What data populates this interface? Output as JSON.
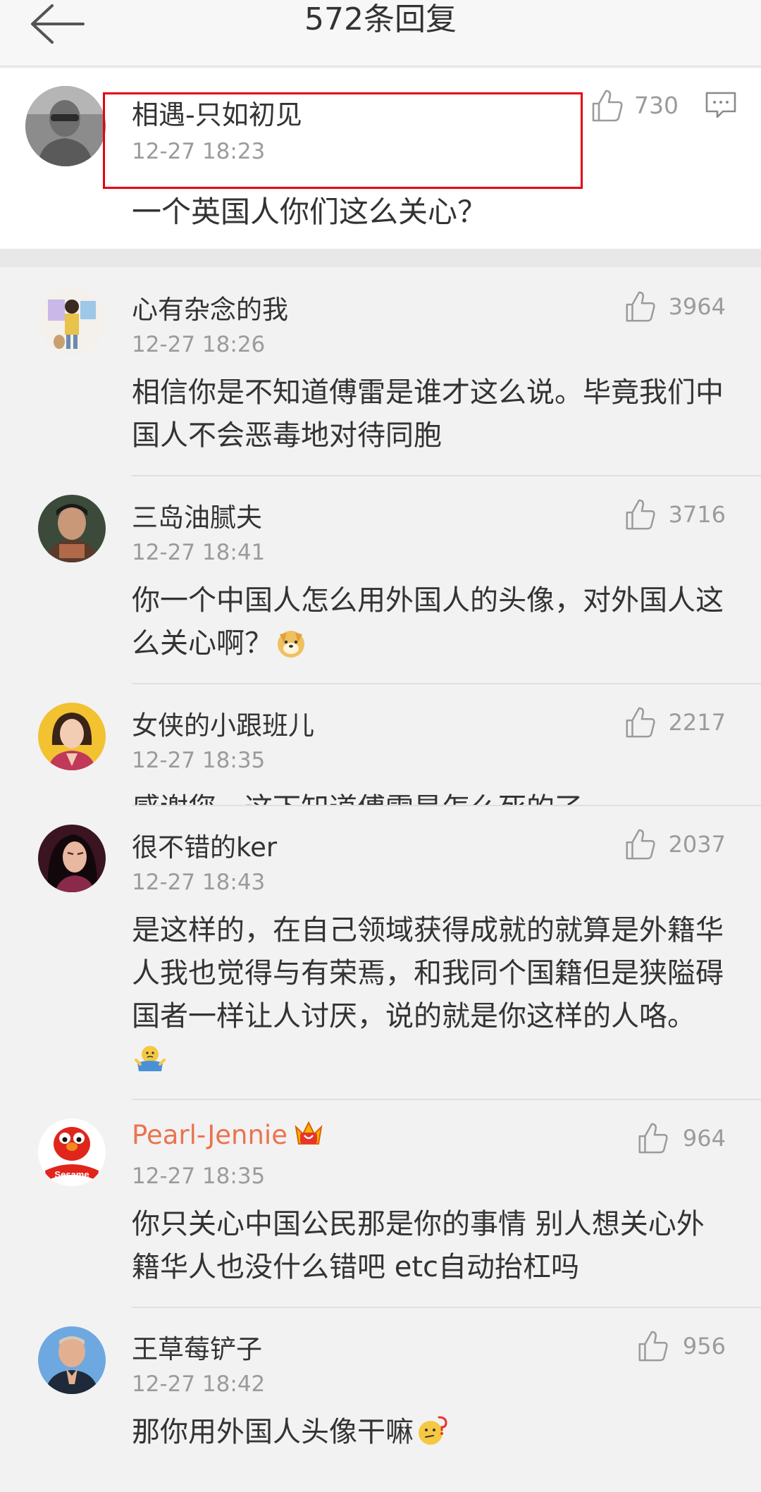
{
  "header": {
    "title": "572条回复",
    "back_icon": "arrow-left-icon"
  },
  "op": {
    "name": "相遇-只如初见",
    "time": "12-27 18:23",
    "likes": "730",
    "text": "一个英国人你们这么关心？",
    "highlight_color": "#e60012"
  },
  "replies": [
    {
      "name": "心有杂念的我",
      "time": "12-27 18:26",
      "likes": "3964",
      "text": "相信你是不知道傅雷是谁才这么说。毕竟我们中国人不会恶毒地对待同胞"
    },
    {
      "name": "三岛油腻夫",
      "time": "12-27 18:41",
      "likes": "3716",
      "text": "你一个中国人怎么用外国人的头像，对外国人这么关心啊？",
      "emoji": "doge-emoji"
    },
    {
      "name": "女侠的小跟班儿",
      "time": "12-27 18:35",
      "likes": "2217",
      "text": "感谢您，这下知道傅雷是怎么死的了"
    },
    {
      "name": "很不错的ker",
      "time": "12-27 18:43",
      "likes": "2037",
      "text": "是这样的，在自己领域获得成就的就算是外籍华人我也觉得与有荣焉，和我同个国籍但是狭隘碍国者一样让人讨厌，说的就是你这样的人咯。",
      "emoji": "shrug-emoji"
    },
    {
      "name": "Pearl-Jennie",
      "time": "12-27 18:35",
      "likes": "964",
      "text": "你只关心中国公民那是你的事情 别人想关心外籍华人也没什么错吧 etc自动抬杠吗",
      "vip_color": "#eb7350"
    },
    {
      "name": "王草莓铲子",
      "time": "12-27 18:42",
      "likes": "956",
      "text": "那你用外国人头像干嘛",
      "emoji": "thinking-emoji"
    }
  ],
  "colors": {
    "background": "#f2f2f2",
    "text": "#333333",
    "meta": "#9b9b9b"
  }
}
